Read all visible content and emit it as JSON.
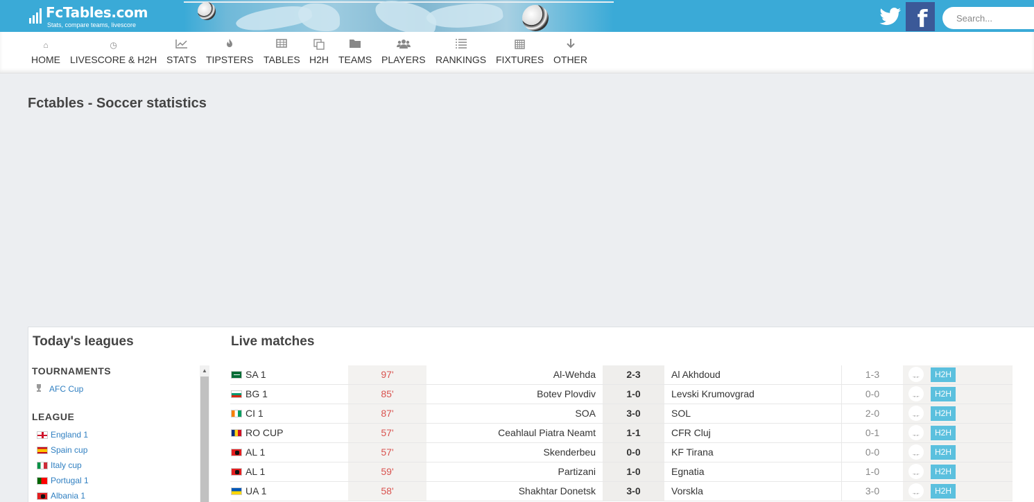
{
  "header": {
    "logo_title": "FcTables.com",
    "logo_subtitle": "Stats, compare teams, livescore",
    "twitter_icon": "twitter-bird-icon",
    "facebook_icon": "facebook-f-icon",
    "facebook_glyph": "f",
    "search_placeholder": "Search..."
  },
  "nav": [
    {
      "label": "HOME",
      "icon": "home-icon",
      "glyph": "⌂"
    },
    {
      "label": "LIVESCORE & H2H",
      "icon": "clock-icon",
      "glyph": "◷"
    },
    {
      "label": "STATS",
      "icon": "line-chart-icon",
      "glyph": "📈"
    },
    {
      "label": "TIPSTERS",
      "icon": "fire-icon",
      "glyph": "🔥"
    },
    {
      "label": "TABLES",
      "icon": "table-icon",
      "glyph": "▦"
    },
    {
      "label": "H2H",
      "icon": "copy-icon",
      "glyph": "❐"
    },
    {
      "label": "TEAMS",
      "icon": "folder-icon",
      "glyph": "▬"
    },
    {
      "label": "PLAYERS",
      "icon": "users-icon",
      "glyph": "👥"
    },
    {
      "label": "RANKINGS",
      "icon": "list-icon",
      "glyph": "☰"
    },
    {
      "label": "FIXTURES",
      "icon": "calendar-icon",
      "glyph": "▦"
    },
    {
      "label": "OTHER",
      "icon": "arrow-down-icon",
      "glyph": "↓"
    }
  ],
  "page_title": "Fctables - Soccer statistics",
  "sidebar": {
    "title": "Today's leagues",
    "tournaments_heading": "TOURNAMENTS",
    "tournaments": [
      {
        "label": "AFC Cup",
        "icon": "trophy-icon",
        "glyph": "🏆"
      }
    ],
    "league_heading": "LEAGUE",
    "leagues": [
      {
        "label": "England 1",
        "flag": "england"
      },
      {
        "label": "Spain cup",
        "flag": "spain"
      },
      {
        "label": "Italy cup",
        "flag": "italy"
      },
      {
        "label": "Portugal 1",
        "flag": "portugal"
      },
      {
        "label": "Albania 1",
        "flag": "albania"
      }
    ]
  },
  "live": {
    "title": "Live matches",
    "bell_icon": "bell-icon",
    "h2h_label": "H2H",
    "matches": [
      {
        "comp": "SA 1",
        "flag": "saudi",
        "minute": "97'",
        "home": "Al-Wehda",
        "score": "2-3",
        "away": "Al Akhdoud",
        "ht": "1-3"
      },
      {
        "comp": "BG 1",
        "flag": "bulgaria",
        "minute": "85'",
        "home": "Botev Plovdiv",
        "score": "1-0",
        "away": "Levski Krumovgrad",
        "ht": "0-0"
      },
      {
        "comp": "CI 1",
        "flag": "ivorycoast",
        "minute": "87'",
        "home": "SOA",
        "score": "3-0",
        "away": "SOL",
        "ht": "2-0"
      },
      {
        "comp": "RO CUP",
        "flag": "romania",
        "minute": "57'",
        "home": "Ceahlaul Piatra Neamt",
        "score": "1-1",
        "away": "CFR Cluj",
        "ht": "0-1"
      },
      {
        "comp": "AL 1",
        "flag": "albania",
        "minute": "57'",
        "home": "Skenderbeu",
        "score": "0-0",
        "away": "KF Tirana",
        "ht": "0-0"
      },
      {
        "comp": "AL 1",
        "flag": "albania",
        "minute": "59'",
        "home": "Partizani",
        "score": "1-0",
        "away": "Egnatia",
        "ht": "1-0"
      },
      {
        "comp": "UA 1",
        "flag": "ukraine",
        "minute": "58'",
        "home": "Shakhtar Donetsk",
        "score": "3-0",
        "away": "Vorskla",
        "ht": "3-0"
      }
    ]
  },
  "colors": {
    "header_blue": "#3aaad7",
    "facebook_blue": "#3b5998",
    "minute_red": "#d9534f",
    "h2h_blue": "#5bc0de",
    "link_blue": "#2f7fc1"
  }
}
